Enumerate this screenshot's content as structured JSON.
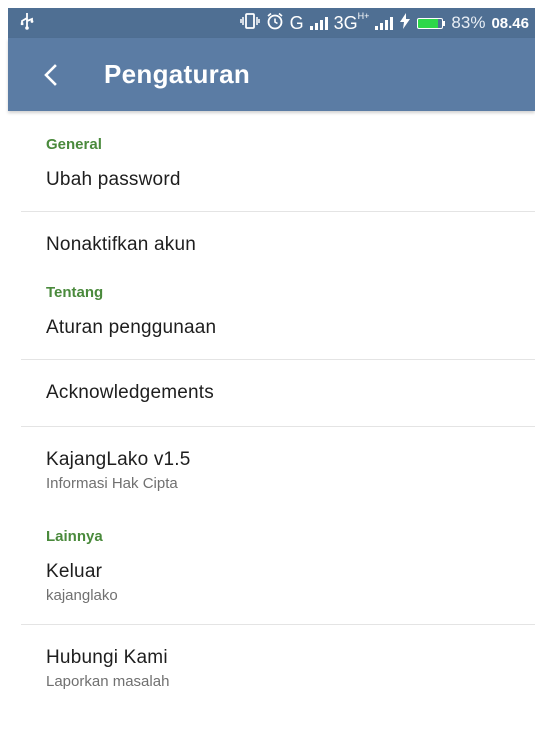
{
  "status_bar": {
    "usb_icon": "usb-icon",
    "vibrate_icon": "vibrate-icon",
    "alarm_icon": "alarm-icon",
    "network_g": "G",
    "network_3g": "3G",
    "network_hplus": "H+",
    "charging_icon": "lightning-icon",
    "battery_percent": "83%",
    "time": "08.46",
    "battery_level": 0.83,
    "battery_color": "#2dd84a"
  },
  "app_bar": {
    "title": "Pengaturan",
    "background": "#5b7ca4"
  },
  "sections": {
    "general": {
      "header": "General",
      "change_password": "Ubah password",
      "deactivate_account": "Nonaktifkan akun"
    },
    "about": {
      "header": "Tentang",
      "terms": "Aturan penggunaan",
      "acknowledgements": "Acknowledgements",
      "version_title": "KajangLako v1.5",
      "version_sub": "Informasi Hak Cipta"
    },
    "other": {
      "header": "Lainnya",
      "logout_title": "Keluar",
      "logout_sub": "kajanglako",
      "contact_title": "Hubungi Kami",
      "contact_sub": "Laporkan masalah"
    }
  },
  "colors": {
    "section_header": "#4a8a3c",
    "status_bar": "#4f6f93"
  }
}
